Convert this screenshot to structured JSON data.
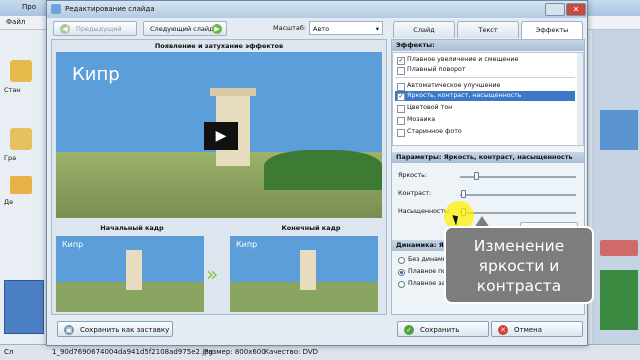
{
  "background_app": {
    "title": "Про",
    "menu_first": "Файл",
    "left_items": [
      "Стан",
      "Гра",
      "Де"
    ],
    "status_left": "Сл"
  },
  "dialog": {
    "title": "Редактирование слайда",
    "prev_button": "Предыдущий слайд",
    "next_button": "Следующий слайд",
    "scale_label": "Масштаб:",
    "scale_value": "Авто",
    "tabs": [
      {
        "label": "Слайд"
      },
      {
        "label": "Текст"
      },
      {
        "label": "Эффекты"
      }
    ],
    "effects_heading": "Появление и затухание эффектов",
    "preview_caption": "Кипр",
    "start_frame_label": "Начальный кадр",
    "end_frame_label": "Конечный кадр",
    "thumb_caption": "Кипр",
    "effects_section": "Эффекты:",
    "effects": [
      {
        "label": "Плавное увеличение и смещение",
        "checked": "✓"
      },
      {
        "label": "Плавный поворот",
        "checked": ""
      },
      {
        "label": "Автоматическое улучшение",
        "checked": ""
      },
      {
        "label": "Яркость, контраст, насыщенность",
        "checked": "✓"
      },
      {
        "label": "Цветовой тон",
        "checked": ""
      },
      {
        "label": "Мозаика",
        "checked": ""
      },
      {
        "label": "Старинное фото",
        "checked": ""
      }
    ],
    "params_section": "Параметры: Яркость, контраст, насыщенность",
    "sliders": [
      {
        "label": "Яркость:",
        "value": 0.12
      },
      {
        "label": "Контраст:",
        "value": 0.01
      },
      {
        "label": "Насыщенность:",
        "value": 0.01
      }
    ],
    "reset_button": "Сброс",
    "dynamics_section": "Динамика: Яркость",
    "radios": [
      {
        "label": "Без динамики",
        "selected": false
      },
      {
        "label": "Плавное появление",
        "selected": true
      },
      {
        "label": "Плавное затухание",
        "selected": false
      }
    ],
    "save_as_screensaver": "Сохранить как заставку",
    "save_button": "Сохранить",
    "cancel_button": "Отмена"
  },
  "status": {
    "file": "1_90d7690674004da941d5f2108ad975e2.jpg",
    "size": "Размер: 800x600",
    "quality": "Качество: DVD"
  },
  "callout": {
    "line1": "Изменение",
    "line2": "яркости и",
    "line3": "контраста"
  },
  "colors": {
    "accent": "#3b79c8",
    "callout": "#7d7d7d",
    "highlight": "#fff000"
  }
}
